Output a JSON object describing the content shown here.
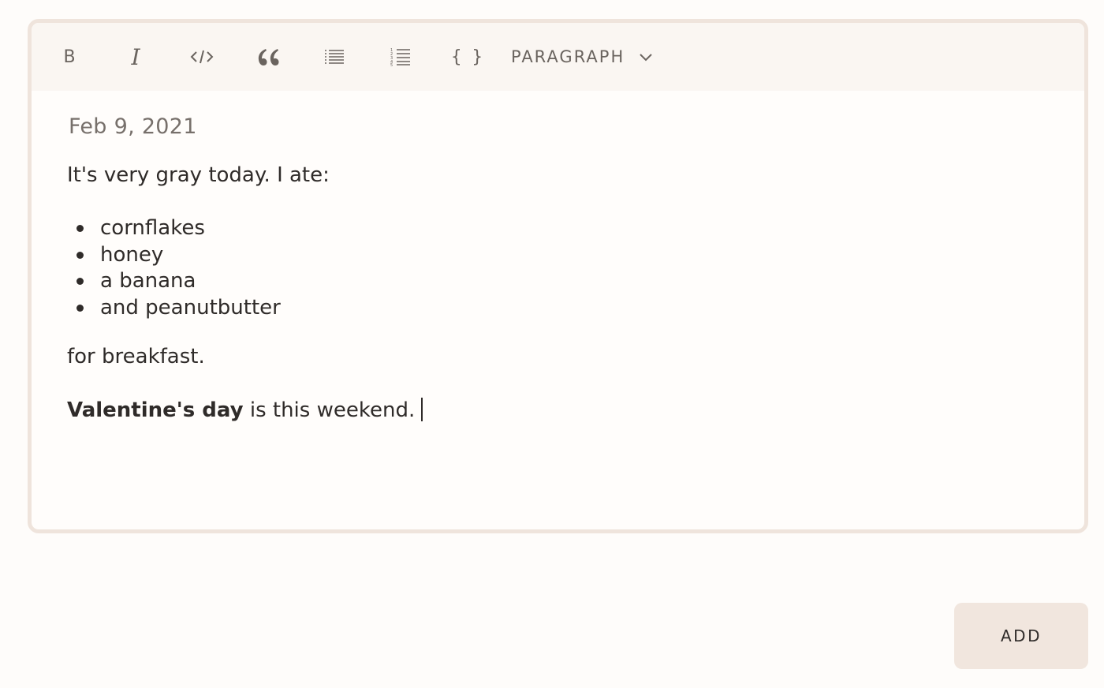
{
  "toolbar": {
    "bold_label": "B",
    "italic_label": "I",
    "braces_label": "{ }",
    "block_type": "PARAGRAPH",
    "icons": [
      "bold-icon",
      "italic-icon",
      "code-icon",
      "blockquote-icon",
      "bullet-list-icon",
      "numbered-list-icon",
      "code-block-icon",
      "chevron-down-icon"
    ]
  },
  "editor": {
    "date": "Feb 9, 2021",
    "paragraph1": "It's very gray today. I ate:",
    "list_items": [
      "cornflakes",
      "honey",
      "a banana",
      "and peanutbutter"
    ],
    "paragraph2": "for breakfast.",
    "paragraph3_bold": "Valentine's day",
    "paragraph3_rest": " is this weekend."
  },
  "actions": {
    "add_label": "ADD"
  },
  "colors": {
    "background": "#fefcfa",
    "toolbar": "#faf6f2",
    "border": "#efe4dc",
    "button": "#f1e6de",
    "text": "#2f2b29",
    "muted": "#6a645f"
  }
}
